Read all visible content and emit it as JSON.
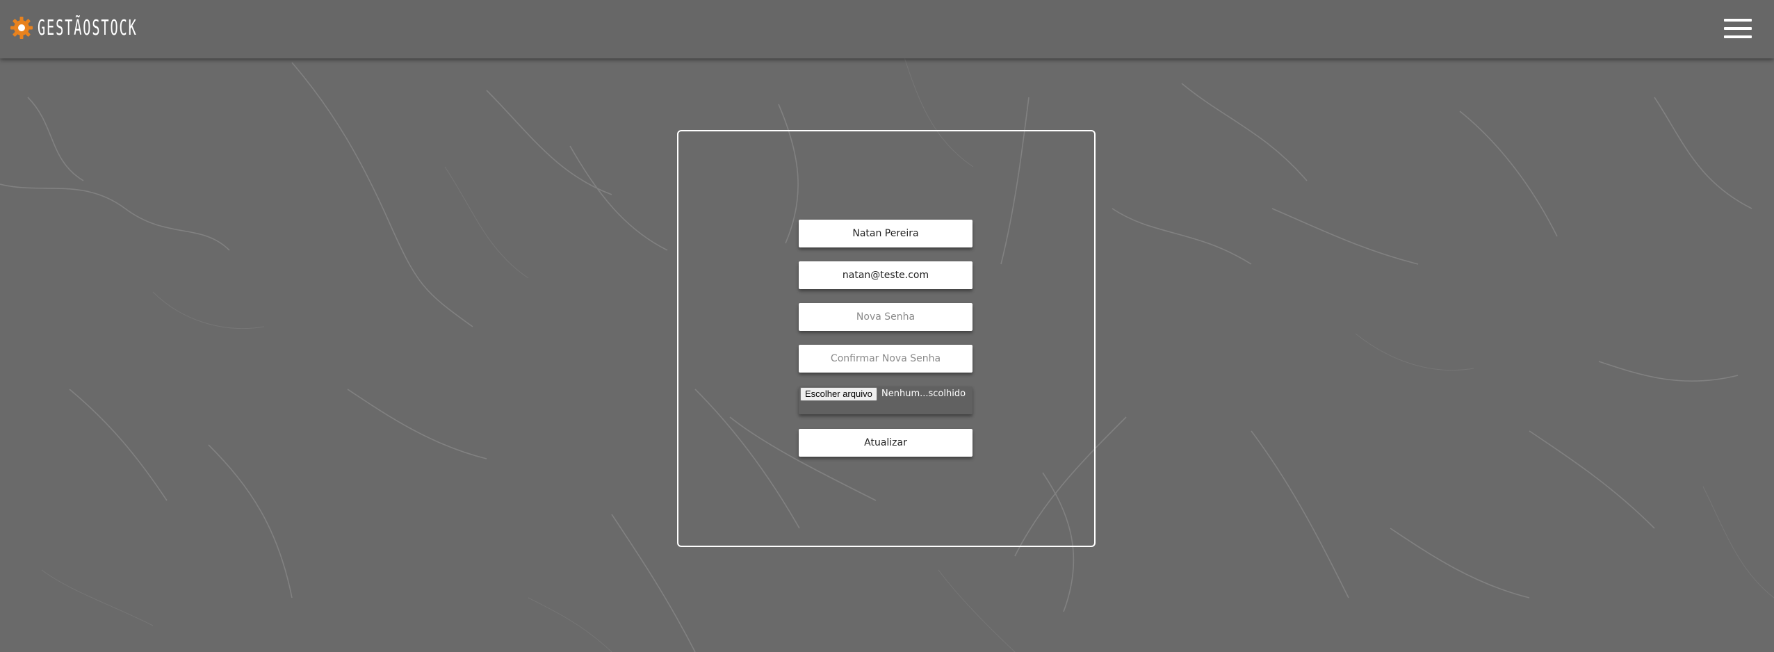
{
  "app": {
    "logo_text": "GESTÃOSTOCK",
    "logo_icon": "gear-icon",
    "menu_icon": "hamburger-menu-icon",
    "accent_color": "#e8821e"
  },
  "form": {
    "name_value": "Natan Pereira",
    "email_value": "natan@teste.com",
    "new_password_placeholder": "Nova Senha",
    "confirm_password_placeholder": "Confirmar Nova Senha",
    "file_button_label": "Escolher arquivo",
    "file_status": "Nenhum...scolhido",
    "submit_label": "Atualizar"
  }
}
